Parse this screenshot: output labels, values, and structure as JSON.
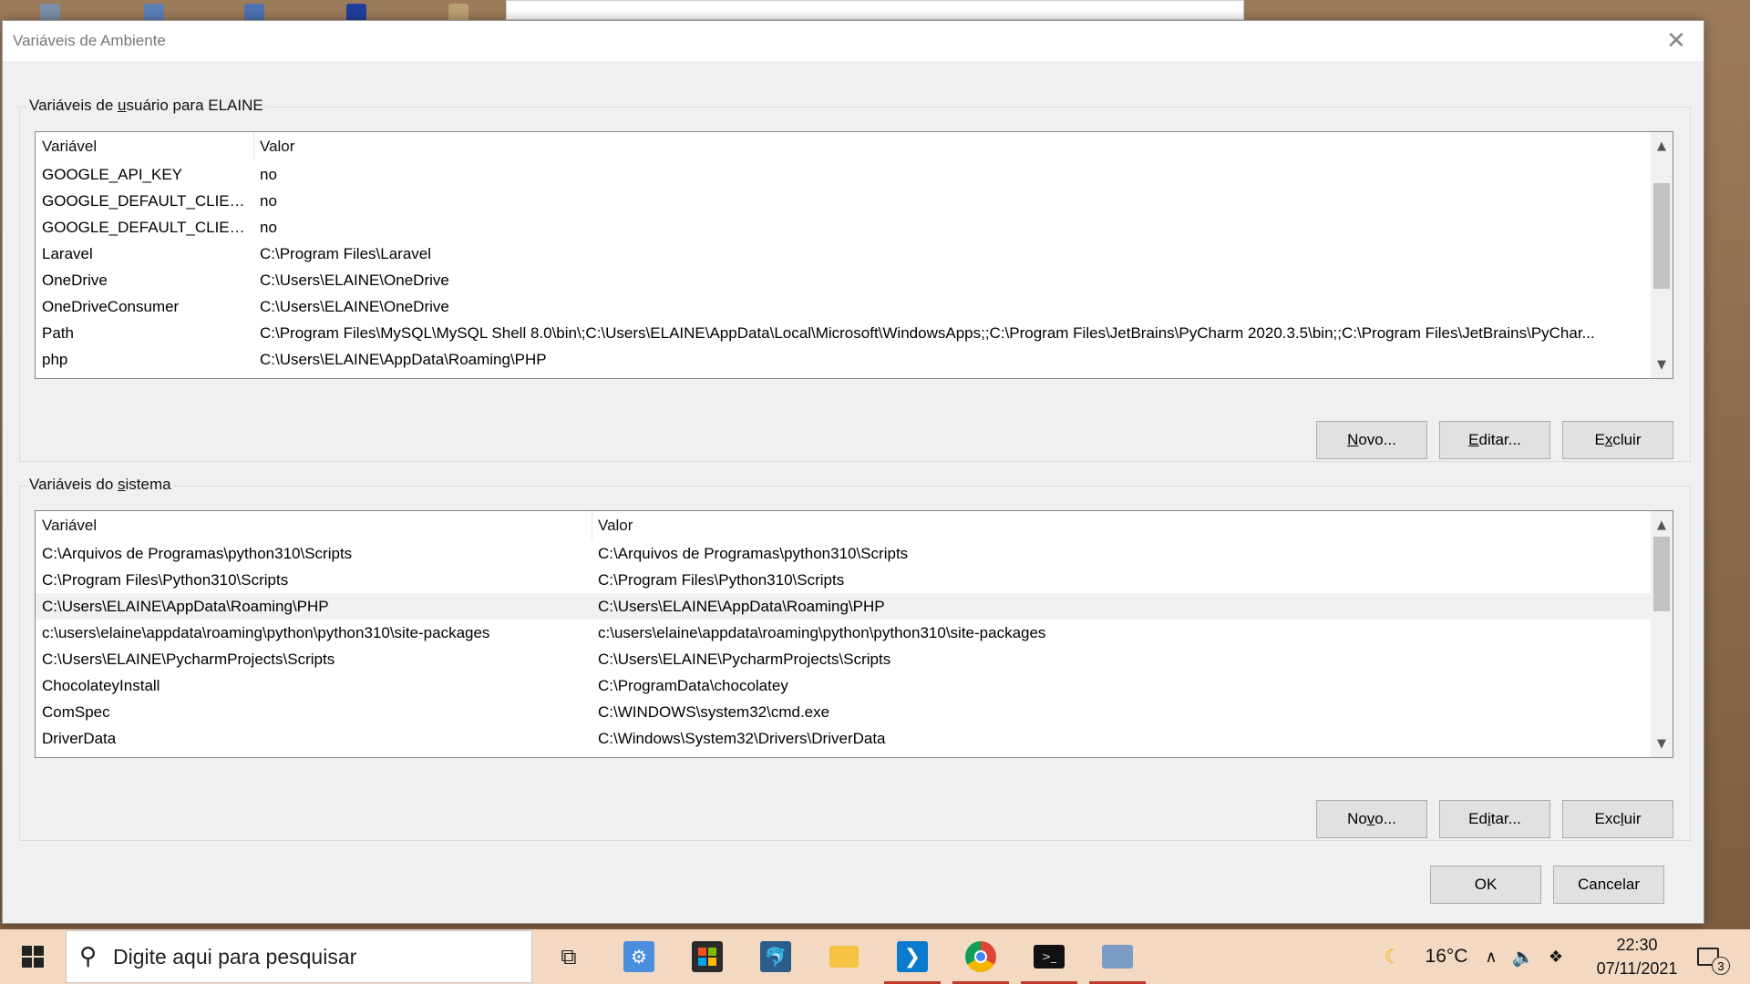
{
  "dialog": {
    "title": "Variáveis de Ambiente",
    "close_glyph": "✕",
    "user_group": {
      "title_pre": "Variáveis de ",
      "title_accel": "u",
      "title_post": "suário para ELAINE",
      "columns": [
        "Variável",
        "Valor"
      ],
      "rows": [
        {
          "name": "GOOGLE_API_KEY",
          "value": "no"
        },
        {
          "name": "GOOGLE_DEFAULT_CLIENT_ID",
          "value": "no"
        },
        {
          "name": "GOOGLE_DEFAULT_CLIENT_...",
          "value": "no"
        },
        {
          "name": "Laravel",
          "value": "C:\\Program Files\\Laravel"
        },
        {
          "name": "OneDrive",
          "value": "C:\\Users\\ELAINE\\OneDrive"
        },
        {
          "name": "OneDriveConsumer",
          "value": "C:\\Users\\ELAINE\\OneDrive"
        },
        {
          "name": "Path",
          "value": "C:\\Program Files\\MySQL\\MySQL Shell 8.0\\bin\\;C:\\Users\\ELAINE\\AppData\\Local\\Microsoft\\WindowsApps;;C:\\Program Files\\JetBrains\\PyCharm 2020.3.5\\bin;;C:\\Program Files\\JetBrains\\PyChar..."
        },
        {
          "name": "php",
          "value": "C:\\Users\\ELAINE\\AppData\\Roaming\\PHP"
        }
      ],
      "buttons": {
        "new": {
          "accel": "N",
          "rest": "ovo..."
        },
        "edit": {
          "accel": "E",
          "rest": "ditar..."
        },
        "delete": {
          "pre": "E",
          "accel": "x",
          "rest": "cluir"
        }
      }
    },
    "system_group": {
      "title_pre": "Variáveis do ",
      "title_accel": "s",
      "title_post": "istema",
      "columns": [
        "Variável",
        "Valor"
      ],
      "selected_index": 2,
      "rows": [
        {
          "name": "C:\\Arquivos de Programas\\python310\\Scripts",
          "value": "C:\\Arquivos de Programas\\python310\\Scripts"
        },
        {
          "name": "C:\\Program Files\\Python310\\Scripts",
          "value": "C:\\Program Files\\Python310\\Scripts"
        },
        {
          "name": "C:\\Users\\ELAINE\\AppData\\Roaming\\PHP",
          "value": "C:\\Users\\ELAINE\\AppData\\Roaming\\PHP"
        },
        {
          "name": "c:\\users\\elaine\\appdata\\roaming\\python\\python310\\site-packages",
          "value": "c:\\users\\elaine\\appdata\\roaming\\python\\python310\\site-packages"
        },
        {
          "name": "C:\\Users\\ELAINE\\PycharmProjects\\Scripts",
          "value": "C:\\Users\\ELAINE\\PycharmProjects\\Scripts"
        },
        {
          "name": "ChocolateyInstall",
          "value": "C:\\ProgramData\\chocolatey"
        },
        {
          "name": "ComSpec",
          "value": "C:\\WINDOWS\\system32\\cmd.exe"
        },
        {
          "name": "DriverData",
          "value": "C:\\Windows\\System32\\Drivers\\DriverData"
        }
      ],
      "buttons": {
        "new": {
          "pre": "No",
          "accel": "v",
          "rest": "o..."
        },
        "edit": {
          "pre": "Ed",
          "accel": "i",
          "rest": "tar..."
        },
        "delete": {
          "pre": "Exc",
          "accel": "l",
          "rest": "uir"
        }
      }
    },
    "ok_label": "OK",
    "cancel_label": "Cancelar"
  },
  "taskbar": {
    "search_placeholder": "Digite aqui para pesquisar",
    "search_icon": "search-icon",
    "apps": [
      "task-view-icon",
      "settings-icon",
      "store-icon",
      "mysql-workbench-icon",
      "file-explorer-icon",
      "vscode-icon",
      "chrome-icon",
      "terminal-icon",
      "remote-desktop-icon"
    ],
    "weather_icon": "moon-icon",
    "temperature": "16°C",
    "time": "22:30",
    "date": "07/11/2021",
    "notification_count": "3"
  },
  "colors": {
    "taskbar_bg": "#f3d8c2",
    "dialog_bg": "#f0f0f0",
    "running_app_underline": "#c0392b"
  }
}
